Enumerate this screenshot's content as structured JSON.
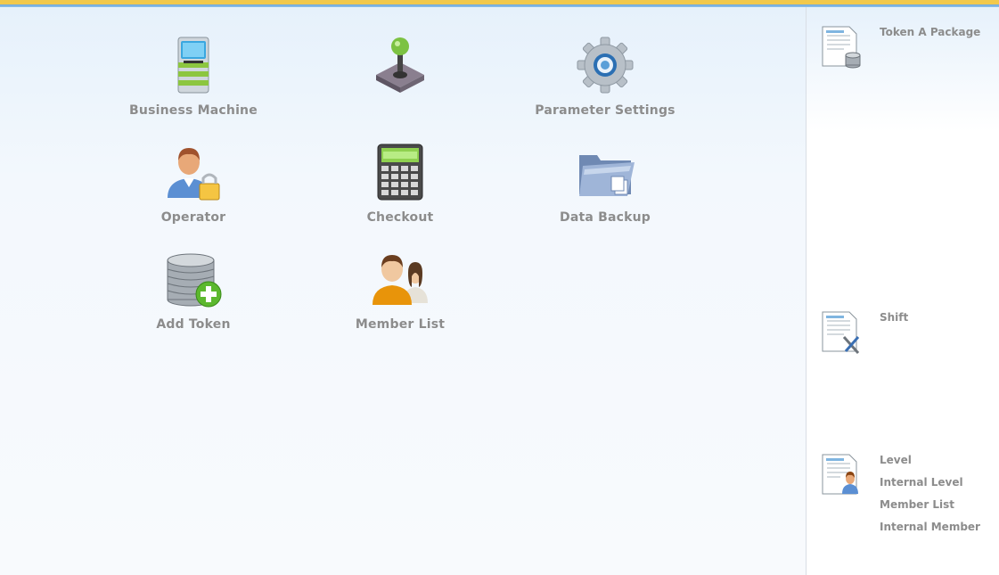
{
  "main": {
    "tiles": [
      {
        "label": "Business Machine",
        "icon": "business-machine-icon"
      },
      {
        "label": "",
        "icon": "joystick-icon"
      },
      {
        "label": "Parameter Settings",
        "icon": "gear-icon"
      },
      {
        "label": "Operator",
        "icon": "operator-lock-icon"
      },
      {
        "label": "Checkout",
        "icon": "calculator-icon"
      },
      {
        "label": "Data Backup",
        "icon": "folder-icon"
      },
      {
        "label": "Add Token",
        "icon": "coin-stack-add-icon"
      },
      {
        "label": "Member List",
        "icon": "members-icon"
      }
    ]
  },
  "side": {
    "groups": [
      {
        "icon": "coin-document-icon",
        "links": [
          "Token A Package"
        ]
      },
      {
        "icon": "tools-document-icon",
        "links": [
          "Shift"
        ]
      },
      {
        "icon": "person-document-icon",
        "links": [
          "Level",
          "Internal Level",
          "Member List",
          "Internal Member"
        ]
      }
    ]
  }
}
